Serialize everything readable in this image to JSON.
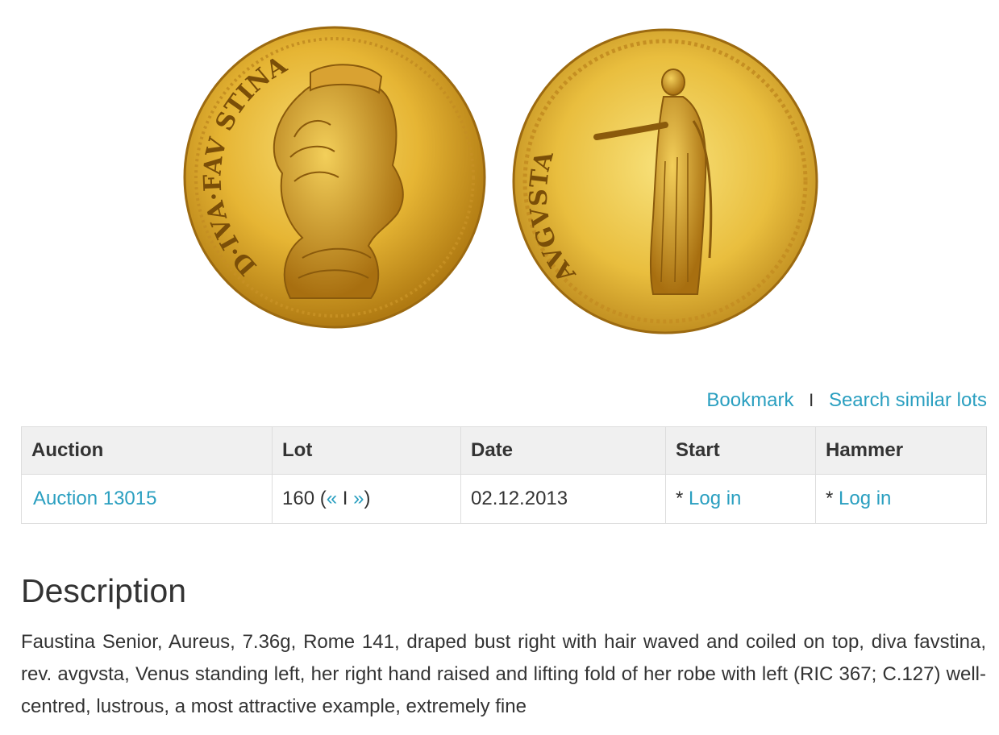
{
  "coin_image": {
    "obverse_legend": "D·IVA·FAV STINA",
    "reverse_legend": "AVGVSTA"
  },
  "actions": {
    "bookmark_label": "Bookmark",
    "separator": "I",
    "search_similar_label": "Search similar lots"
  },
  "table": {
    "headers": {
      "auction": "Auction",
      "lot": "Lot",
      "date": "Date",
      "start": "Start",
      "hammer": "Hammer"
    },
    "row": {
      "auction_link": "Auction 13015",
      "lot_number": "160",
      "lot_nav_prev": "«",
      "lot_nav_sep": "I",
      "lot_nav_next": "»",
      "date": "02.12.2013",
      "start_prefix": "*",
      "start_link": "Log in",
      "hammer_prefix": "*",
      "hammer_link": "Log in"
    }
  },
  "description": {
    "title": "Description",
    "text": "Faustina Senior, Aureus, 7.36g, Rome 141, draped bust right with hair waved and coiled on top, diva favstina, rev. avgvsta, Venus standing left, her right hand raised and lifting fold of her robe with left (RIC 367; C.127) well-centred, lustrous, a most attractive example, extremely fine"
  },
  "colors": {
    "link": "#2a9fc0",
    "text": "#333333",
    "header_bg": "#f0f0f0",
    "border": "#dddddd",
    "gold": "#e8b83a"
  }
}
